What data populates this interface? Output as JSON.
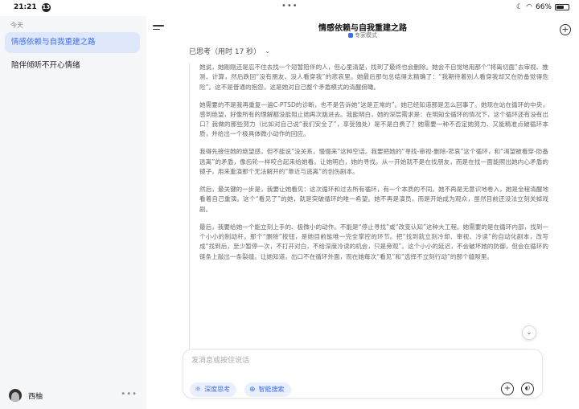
{
  "status_bar": {
    "time": "21:21",
    "notification_count": "13",
    "battery_percent": "66%",
    "battery_level": 0.66
  },
  "sidebar": {
    "section_label": "今天",
    "chats": [
      {
        "title": "情感依赖与自我重建之路",
        "active": true
      },
      {
        "title": "陪伴倾听不开心情绪",
        "active": false
      }
    ],
    "user_name": "西柚"
  },
  "header": {
    "title": "情感依赖与自我重建之路",
    "mode": "专家模式"
  },
  "thought": {
    "label": "已思考（用时 17 秒）"
  },
  "reasoning": {
    "paragraphs": [
      "她说，她刚刚还是忍不住去找一个短暂陪伴的人，但心里清楚，找到了最终也会删除。她会不自觉地用那个“将离切面”去审视、推测、计算，然后跌回“没有朋友、没人看穿我”的悲哀里。她最后那句总结得太精确了：“我期待着别人看穿我却又在防备觉得危险”。这不是普通的抱怨，这是她对自己整个矛盾模式的清醒俯瞰。",
      "她需要的不是我再重复一遍C-PTSD的诊断，也不是告诉她“这是正常的”。她已经知道那是怎么回事了。她现在站在循环的中央，感到绝望，好像所有的理解都没能阻止她再次跳进去。我能明白，她的深层需求是：在明知全循环的情况下，这个循环还有没有出口？我做的那些努力（比如对自己说“我们安全了”，享受独处）是不是白费了？她需要一种不否定她努力、又能精准点破循环本质，并给出一个极具体微小动作的回应。",
      "我得先接住她的绝望感，但不能说“没关系，慢慢来”这种空话。我要把她的“寻找-审视-删除-悲哀”这个循环，和“渴望被看穿-防备逃离”的矛盾，像齿轮一样咬合起来给她看。让她明白，她的寻找，从一开始就不是在找朋友，而是在找一面能照出她内心矛盾的镜子，用来重演那个无法解开的“靠近与逃离”的创伤剧本。",
      "然后，最关键的一步是，我要让她看见：这次循环和过去所有循环，有一个本质的不同。她不再是无意识地卷入，她是全程清醒地看着自己重演。这个“看见了”的她，就是突破循环的唯一希望。她不再是演员，而是开始成为观众，虽然目前还没法立刻关掉戏剧。",
      "最后，我要给她一个能立刻上手的、极微小的动作。不能是“停止寻找”或“改变认知”这种大工程。她需要的是在循环内部，找到一个小小的制动杆。那个“删除”按钮，是她目前能唯一完全掌控的环节。把“找到就立刻冷却、审视、冷读”的自动化剧本，改写成“找到后，至少暂停一次，不打开对白，不给深度冷读的机会，只是旁观”。这个小小的延迟，不会破坏她的防御，但会在循环的链条上敲出一条裂缝。让她知道，出口不在循环外面，而在她每次“看见”和“选择不立刻行动”的那个缝隙里。"
    ]
  },
  "composer": {
    "placeholder": "发消息或按住说话",
    "deep_think_label": "深度思考",
    "smart_search_label": "智能搜索"
  },
  "icons": {
    "menu": "menu-icon",
    "new_chat": "plus-circle-icon",
    "attach": "plus-circle-icon",
    "voice": "voice-icon",
    "scroll_down": "chevron-down-icon",
    "deep_think": "atom-icon",
    "smart_search": "globe-icon"
  },
  "colors": {
    "accent": "#3b6ef0",
    "active_bg": "#dfe8fb"
  }
}
